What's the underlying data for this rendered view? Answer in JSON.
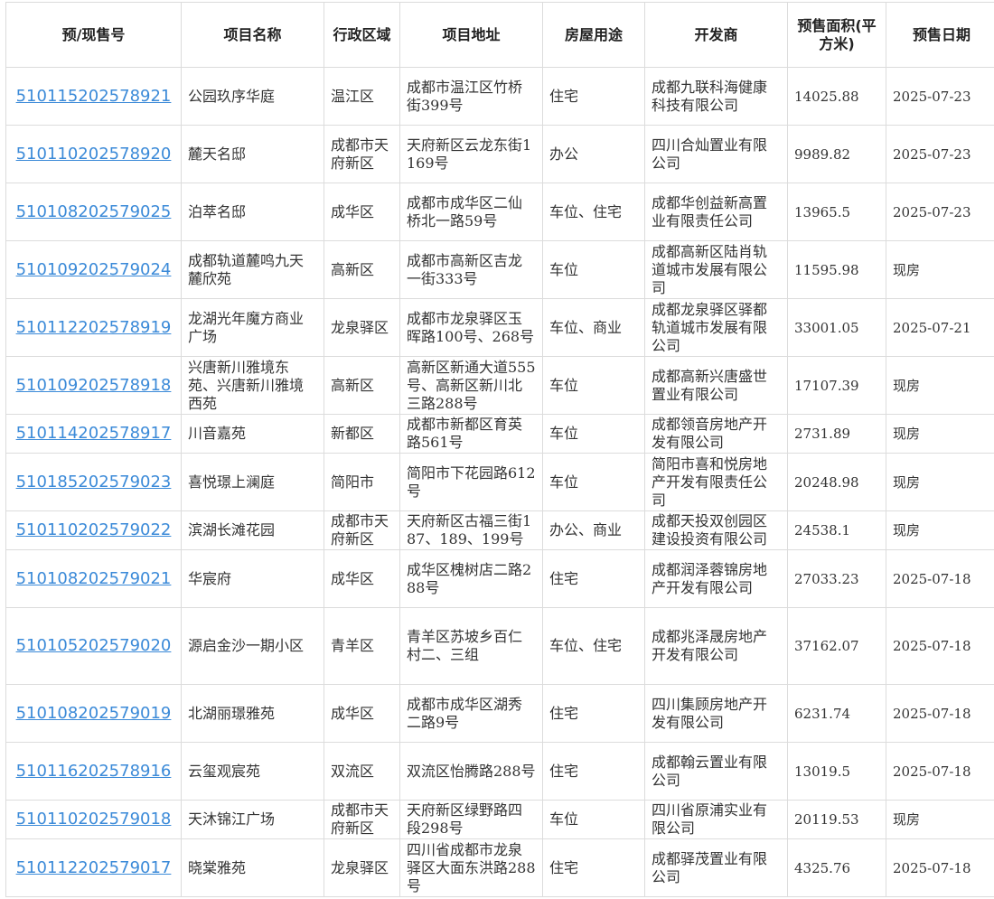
{
  "headers": [
    "预/现售号",
    "项目名称",
    "行政区域",
    "项目地址",
    "房屋用途",
    "开发商",
    "预售面积(平方米)",
    "预售日期"
  ],
  "rows": [
    {
      "code": "510115202578921",
      "name": "公园玖序华庭",
      "district": "温江区",
      "address": "成都市温江区竹桥街399号",
      "use": "住宅",
      "developer": "成都九联科海健康科技有限公司",
      "area": "14025.88",
      "date": "2025-07-23"
    },
    {
      "code": "510110202578920",
      "name": "麓天名邸",
      "district": "成都市天府新区",
      "address": "天府新区云龙东街1169号",
      "use": "办公",
      "developer": "四川合灿置业有限公司",
      "area": "9989.82",
      "date": "2025-07-23"
    },
    {
      "code": "510108202579025",
      "name": "泊萃名邸",
      "district": "成华区",
      "address": "成都市成华区二仙桥北一路59号",
      "use": "车位、住宅",
      "developer": "成都华创益新高置业有限责任公司",
      "area": "13965.5",
      "date": "2025-07-23"
    },
    {
      "code": "510109202579024",
      "name": "成都轨道麓鸣九天麓欣苑",
      "district": "高新区",
      "address": "成都市高新区吉龙一街333号",
      "use": "车位",
      "developer": "成都高新区陆肖轨道城市发展有限公司",
      "area": "11595.98",
      "date": "现房"
    },
    {
      "code": "510112202578919",
      "name": "龙湖光年魔方商业广场",
      "district": "龙泉驿区",
      "address": "成都市龙泉驿区玉晖路100号、268号",
      "use": "车位、商业",
      "developer": "成都龙泉驿区驿都轨道城市发展有限公司",
      "area": "33001.05",
      "date": "2025-07-21"
    },
    {
      "code": "510109202578918",
      "name": "兴唐新川雅境东苑、兴唐新川雅境西苑",
      "district": "高新区",
      "address": "高新区新通大道555号、高新区新川北三路288号",
      "use": "车位",
      "developer": "成都高新兴唐盛世置业有限公司",
      "area": "17107.39",
      "date": "现房"
    },
    {
      "code": "510114202578917",
      "name": "川音嘉苑",
      "district": "新都区",
      "address": "成都市新都区育英路561号",
      "use": "车位",
      "developer": "成都领音房地产开发有限公司",
      "area": "2731.89",
      "date": "现房"
    },
    {
      "code": "510185202579023",
      "name": "喜悦璟上澜庭",
      "district": "简阳市",
      "address": "简阳市下花园路612号",
      "use": "车位",
      "developer": "简阳市喜和悦房地产开发有限责任公司",
      "area": "20248.98",
      "date": "现房"
    },
    {
      "code": "510110202579022",
      "name": "滨湖长滩花园",
      "district": "成都市天府新区",
      "address": "天府新区古福三街187、189、199号",
      "use": "办公、商业",
      "developer": "成都天投双创园区建设投资有限公司",
      "area": "24538.1",
      "date": "现房"
    },
    {
      "code": "510108202579021",
      "name": "华宸府",
      "district": "成华区",
      "address": "成华区槐树店二路288号",
      "use": "住宅",
      "developer": "成都润泽蓉锦房地产开发有限公司",
      "area": "27033.23",
      "date": "2025-07-18"
    },
    {
      "code": "510105202579020",
      "name": "源启金沙一期小区",
      "district": "青羊区",
      "address": "青羊区苏坡乡百仁村二、三组",
      "use": "车位、住宅",
      "developer": "成都兆泽晟房地产开发有限公司",
      "area": "37162.07",
      "date": "2025-07-18"
    },
    {
      "code": "510108202579019",
      "name": "北湖丽璟雅苑",
      "district": "成华区",
      "address": "成都市成华区湖秀二路9号",
      "use": "住宅",
      "developer": "四川集顾房地产开发有限公司",
      "area": "6231.74",
      "date": "2025-07-18"
    },
    {
      "code": "510116202578916",
      "name": "云玺观宸苑",
      "district": "双流区",
      "address": "双流区怡腾路288号",
      "use": "住宅",
      "developer": "成都翰云置业有限公司",
      "area": "13019.5",
      "date": "2025-07-18"
    },
    {
      "code": "510110202579018",
      "name": "天沐锦江广场",
      "district": "成都市天府新区",
      "address": "天府新区绿野路四段298号",
      "use": "车位",
      "developer": "四川省原浦实业有限公司",
      "area": "20119.53",
      "date": "现房"
    },
    {
      "code": "510112202579017",
      "name": "晓棠雅苑",
      "district": "龙泉驿区",
      "address": "四川省成都市龙泉驿区大面东洪路288号",
      "use": "住宅",
      "developer": "成都驿茂置业有限公司",
      "area": "4325.76",
      "date": "2025-07-18"
    }
  ]
}
